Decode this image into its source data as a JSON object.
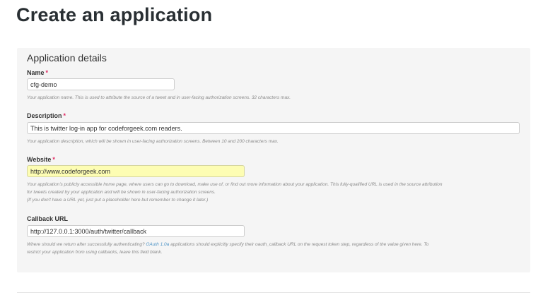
{
  "page": {
    "title": "Create an application"
  },
  "panel": {
    "heading": "Application details"
  },
  "fields": {
    "name": {
      "label": "Name",
      "required_mark": "*",
      "value": "cfg-demo",
      "help": "Your application name. This is used to attribute the source of a tweet and in user-facing authorization screens. 32 characters max."
    },
    "description": {
      "label": "Description",
      "required_mark": "*",
      "value": "This is twitter log-in app for codeforgeek.com readers.",
      "help": "Your application description, which will be shown in user-facing authorization screens. Between 10 and 200 characters max."
    },
    "website": {
      "label": "Website",
      "required_mark": "*",
      "value": "http://www.codeforgeek.com",
      "help_line1": "Your application's publicly accessible home page, where users can go to download, make use of, or find out more information about your application. This fully-qualified URL is used in the source attribution",
      "help_line2": "for tweets created by your application and will be shown in user-facing authorization screens.",
      "help_line3": "(If you don't have a URL yet, just put a placeholder here but remember to change it later.)"
    },
    "callback": {
      "label": "Callback URL",
      "value": "http://127.0.0.1:3000/auth/twitter/callback",
      "help_pre": "Where should we return after successfully authenticating?",
      "help_link": "OAuth 1.0a",
      "help_post": "applications should explicitly specify their oauth_callback URL on the request token step, regardless of the value given here. To",
      "help_line2": "restrict your application from using callbacks, leave this field blank."
    }
  }
}
